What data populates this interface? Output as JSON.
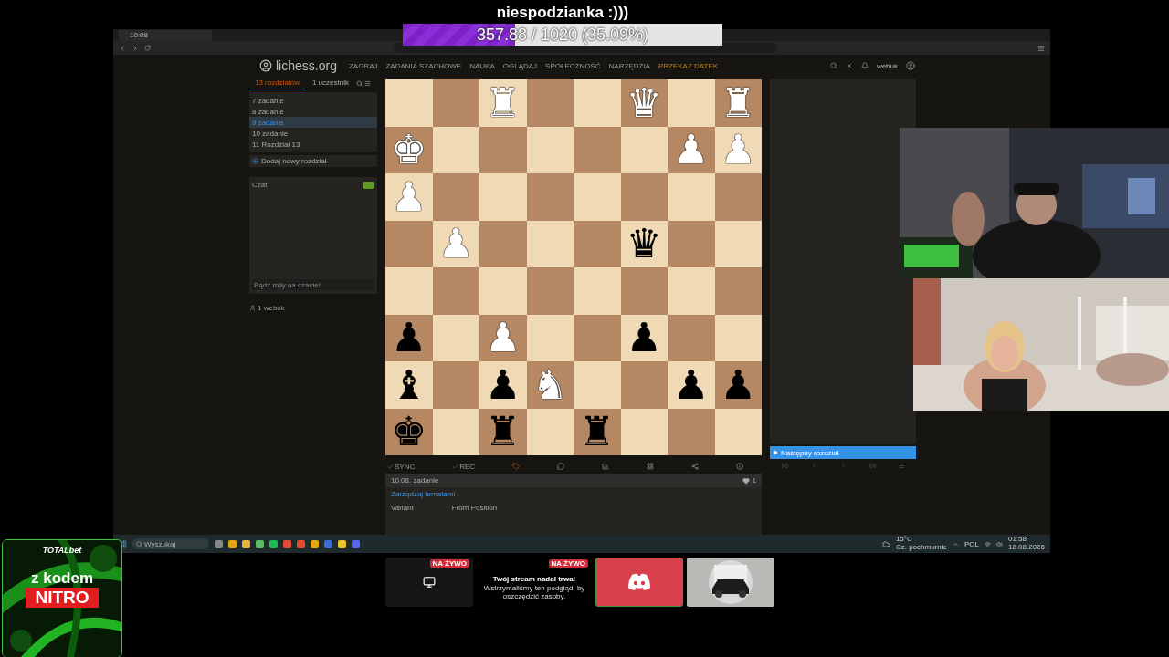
{
  "alert": {
    "title": "niespodzianka :)))",
    "progress": {
      "label": "357.88 / 1020 (35.09%)",
      "level": 0.3509
    }
  },
  "browser": {
    "tab_title": "10:08"
  },
  "site": {
    "logo": "lichess.org",
    "nav": [
      {
        "label": "ZAGRAJ",
        "kind": "plain"
      },
      {
        "label": "ZADANIA SZACHOWE",
        "kind": "plain"
      },
      {
        "label": "NAUKA",
        "kind": "plain"
      },
      {
        "label": "OGLĄDAJ",
        "kind": "plain"
      },
      {
        "label": "SPOŁECZNOŚĆ",
        "kind": "plain"
      },
      {
        "label": "NARZĘDZIA",
        "kind": "plain"
      },
      {
        "label": "PRZEKAŻ DATEK",
        "kind": "donate"
      }
    ],
    "user": "webuk"
  },
  "study": {
    "tabs": [
      {
        "label": "13 rozdziałów",
        "selected": true
      },
      {
        "label": "1 uczestnik",
        "selected": false
      }
    ],
    "chapters": [
      {
        "number": "7",
        "name": "zadanie",
        "selected": false
      },
      {
        "number": "8",
        "name": "zadanie",
        "selected": false
      },
      {
        "number": "9",
        "name": "zadanie",
        "selected": true
      },
      {
        "number": "10",
        "name": "zadanie",
        "selected": false
      },
      {
        "number": "11",
        "name": "Rozdział 13",
        "selected": false
      }
    ],
    "add_chapter": "Dodaj nowy rozdział",
    "chat": {
      "title": "Czat",
      "on": true,
      "placeholder": "Bądź miły na czacie!"
    },
    "members": "1 webuk"
  },
  "board": {
    "ranks": [
      [
        {
          "kind": "empty"
        },
        {
          "kind": "empty"
        },
        {
          "kind": "piece",
          "glyph": "♜",
          "color": "#ffffff"
        },
        {
          "kind": "empty"
        },
        {
          "kind": "empty"
        },
        {
          "kind": "piece",
          "glyph": "♛",
          "color": "#ffffff"
        },
        {
          "kind": "empty"
        },
        {
          "kind": "piece",
          "glyph": "♜",
          "color": "#ffffff"
        }
      ],
      [
        {
          "kind": "piece",
          "glyph": "♚",
          "color": "#ffffff"
        },
        {
          "kind": "empty"
        },
        {
          "kind": "empty"
        },
        {
          "kind": "empty"
        },
        {
          "kind": "empty"
        },
        {
          "kind": "empty"
        },
        {
          "kind": "piece",
          "glyph": "♟",
          "color": "#ffffff"
        },
        {
          "kind": "piece",
          "glyph": "♟",
          "color": "#ffffff"
        }
      ],
      [
        {
          "kind": "piece",
          "glyph": "♟",
          "color": "#ffffff"
        },
        {
          "kind": "empty"
        },
        {
          "kind": "empty"
        },
        {
          "kind": "empty"
        },
        {
          "kind": "empty"
        },
        {
          "kind": "empty"
        },
        {
          "kind": "empty"
        },
        {
          "kind": "empty"
        }
      ],
      [
        {
          "kind": "empty"
        },
        {
          "kind": "piece",
          "glyph": "♟",
          "color": "#ffffff"
        },
        {
          "kind": "empty"
        },
        {
          "kind": "empty"
        },
        {
          "kind": "empty"
        },
        {
          "kind": "piece",
          "glyph": "♛",
          "color": "#000000"
        },
        {
          "kind": "empty"
        },
        {
          "kind": "empty"
        }
      ],
      [
        {
          "kind": "empty"
        },
        {
          "kind": "empty"
        },
        {
          "kind": "empty"
        },
        {
          "kind": "empty"
        },
        {
          "kind": "empty"
        },
        {
          "kind": "empty"
        },
        {
          "kind": "empty"
        },
        {
          "kind": "empty"
        }
      ],
      [
        {
          "kind": "piece",
          "glyph": "♟",
          "color": "#000000"
        },
        {
          "kind": "empty"
        },
        {
          "kind": "piece",
          "glyph": "♟",
          "color": "#ffffff"
        },
        {
          "kind": "empty"
        },
        {
          "kind": "empty"
        },
        {
          "kind": "piece",
          "glyph": "♟",
          "color": "#000000"
        },
        {
          "kind": "empty"
        },
        {
          "kind": "empty"
        }
      ],
      [
        {
          "kind": "piece",
          "glyph": "♝",
          "color": "#000000"
        },
        {
          "kind": "empty"
        },
        {
          "kind": "piece",
          "glyph": "♟",
          "color": "#000000"
        },
        {
          "kind": "piece",
          "glyph": "♞",
          "color": "#ffffff"
        },
        {
          "kind": "empty"
        },
        {
          "kind": "empty"
        },
        {
          "kind": "piece",
          "glyph": "♟",
          "color": "#000000"
        },
        {
          "kind": "piece",
          "glyph": "♟",
          "color": "#000000"
        }
      ],
      [
        {
          "kind": "piece",
          "glyph": "♚",
          "color": "#000000"
        },
        {
          "kind": "empty"
        },
        {
          "kind": "piece",
          "glyph": "♜",
          "color": "#000000"
        },
        {
          "kind": "empty"
        },
        {
          "kind": "piece",
          "glyph": "♜",
          "color": "#000000"
        },
        {
          "kind": "empty"
        },
        {
          "kind": "empty"
        },
        {
          "kind": "empty"
        }
      ]
    ]
  },
  "toolbar": {
    "sync": "SYNC",
    "rec": "REC"
  },
  "chapter_info": {
    "title": "10.08. zadanie",
    "likes": "1",
    "topics": "Zarządzaj tematami",
    "variant_label": "Variant",
    "variant_value": "From Position"
  },
  "next_chapter": "Następny rozdział",
  "taskbar": {
    "search": "Wyszukaj",
    "temperature": "15°C",
    "weather": "Cz. pochmurnie",
    "language": "POL",
    "time": "01:58",
    "date": "18.08.2026"
  },
  "ad": {
    "brand": "TOTALbet",
    "line1": "z kodem",
    "code": "NITRO"
  },
  "cards": [
    {
      "kind": "paused",
      "badge": "NA ŻYWO"
    },
    {
      "kind": "message",
      "badge": "NA ŻYWO",
      "title": "Twój stream nadal trwa!",
      "text": "Wstrzymaliśmy ten podgląd, by oszczędzić zasoby."
    },
    {
      "kind": "discord"
    },
    {
      "kind": "picture"
    }
  ]
}
